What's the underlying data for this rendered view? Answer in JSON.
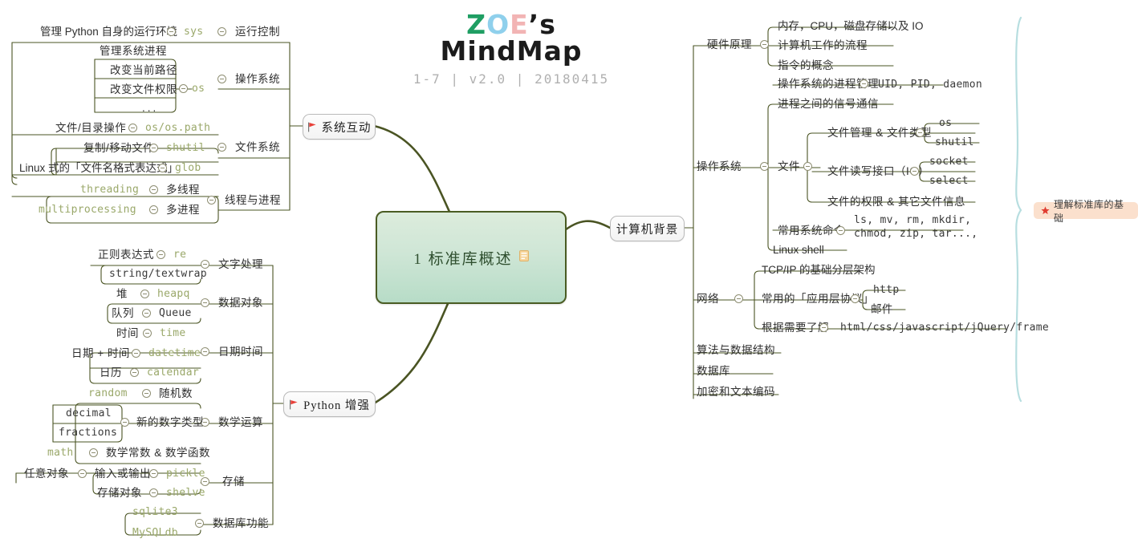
{
  "header": {
    "brand_z": "Z",
    "brand_o": "O",
    "brand_e": "E",
    "brand_rest": "’s MindMap",
    "subtitle": "1-7 | v2.0 | 20180415"
  },
  "central": {
    "label": "1  标准库概述",
    "note_icon": "note-icon"
  },
  "main_branches": {
    "left_top": "系统互动",
    "left_bottom": "Python 增强",
    "right": "计算机背景"
  },
  "summary": {
    "label": "理解标准库的基础",
    "icon": "star-icon"
  },
  "left_top_branch": {
    "categories": [
      {
        "label": "运行控制",
        "toggle": true
      },
      {
        "label": "操作系统",
        "toggle": true
      },
      {
        "label": "文件系统",
        "toggle": true
      },
      {
        "label": "线程与进程",
        "toggle": true
      }
    ],
    "rows": [
      {
        "desc": "管理 Python 自身的运行环境",
        "module": "sys"
      },
      {
        "desc": "管理系统进程",
        "module": ""
      },
      {
        "desc": "改变当前路径",
        "module": ""
      },
      {
        "desc": "改变文件权限",
        "module": ""
      },
      {
        "desc": "...",
        "module": ""
      },
      {
        "desc": "文件/目录操作",
        "module": "os/os.path"
      },
      {
        "desc": "复制/移动文件",
        "module": "shutil"
      },
      {
        "desc": "Linux 式的「文件名格式表达式」",
        "module": "glob"
      },
      {
        "desc": "多线程",
        "module": "threading"
      },
      {
        "desc": "多进程",
        "module": "multiprocessing"
      }
    ],
    "os_module": "os"
  },
  "left_bottom_branch": {
    "categories": [
      {
        "label": "文字处理",
        "toggle": true
      },
      {
        "label": "数据对象",
        "toggle": true
      },
      {
        "label": "日期时间",
        "toggle": true
      },
      {
        "label": "数学运算",
        "toggle": true
      },
      {
        "label": "存储",
        "toggle": true
      },
      {
        "label": "数据库功能",
        "toggle": true
      }
    ],
    "rows": [
      {
        "desc": "正则表达式",
        "module": "re"
      },
      {
        "desc": "",
        "module": "string/textwrap"
      },
      {
        "desc": "堆",
        "module": "heapq"
      },
      {
        "desc": "队列",
        "module": "Queue"
      },
      {
        "desc": "时间",
        "module": "time"
      },
      {
        "desc": "日期 + 时间",
        "module": "datetime"
      },
      {
        "desc": "日历",
        "module": "calendar"
      },
      {
        "desc": "随机数",
        "module": "random"
      },
      {
        "desc": "",
        "module": "decimal"
      },
      {
        "desc": "",
        "module": "fractions"
      },
      {
        "desc": "数学常数 & 数学函数",
        "module": "math"
      },
      {
        "desc": "任意对象 / 输入或输出",
        "module": "pickle"
      },
      {
        "desc": "存储对象",
        "module": "shelve"
      },
      {
        "desc": "",
        "module": "sqlite3"
      },
      {
        "desc": "",
        "module": "MySQLdb"
      }
    ],
    "new_number_type": "新的数字类型",
    "arbitrary_object": "任意对象",
    "input_output": "输入或输出",
    "store_object": "存储对象"
  },
  "right_branch": {
    "categories": [
      {
        "label": "硬件原理",
        "toggle": true
      },
      {
        "label": "操作系统",
        "toggle": true
      },
      {
        "label": "网络",
        "toggle": true
      },
      {
        "label": "算法与数据结构",
        "toggle": false
      },
      {
        "label": "数据库",
        "toggle": false
      },
      {
        "label": "加密和文本编码",
        "toggle": false
      }
    ],
    "hardware_items": [
      "内存，CPU，磁盘存储以及 IO",
      "计算机工作的流程",
      "指令的概念"
    ],
    "os_items": [
      {
        "label": "操作系统的进程管理",
        "toggle": true,
        "value": "UID, PID, daemon"
      },
      {
        "label": "进程之间的信号通信",
        "toggle": false,
        "value": ""
      },
      {
        "label": "文件",
        "toggle": true,
        "value": ""
      },
      {
        "label": "常用系统命令",
        "toggle": true,
        "value": "ls, mv, rm, mkdir,\nchmod, zip, tar...,"
      },
      {
        "label": "Linux shell",
        "toggle": false,
        "value": ""
      }
    ],
    "file_items": [
      {
        "label": "文件管理 & 文件类型",
        "toggle": true,
        "children": [
          "os",
          "shutil"
        ]
      },
      {
        "label": "文件读写接口（IO）",
        "toggle": true,
        "children": [
          "socket",
          "select"
        ]
      },
      {
        "label": "文件的权限 & 其它文件信息",
        "toggle": false,
        "children": []
      }
    ],
    "syscmd_line1": "ls, mv, rm, mkdir,",
    "syscmd_line2": "chmod, zip, tar...,",
    "net_items": [
      {
        "label": "TCP/IP 的基础分层架构",
        "toggle": false,
        "children": []
      },
      {
        "label": "常用的「应用层协议」",
        "toggle": true,
        "children": [
          "http",
          "邮件"
        ]
      },
      {
        "label": "根据需要了解",
        "toggle": true,
        "value": "html/css/javascript/jQuery/frame"
      }
    ]
  },
  "colors": {
    "line": "#4a5423",
    "code_olive": "#9aa86a",
    "central_border": "#4a5c23",
    "brace": "#b7ded2",
    "badge_bg": "#fbe0cd",
    "star": "#e03c31",
    "flag": "#e8413a"
  }
}
